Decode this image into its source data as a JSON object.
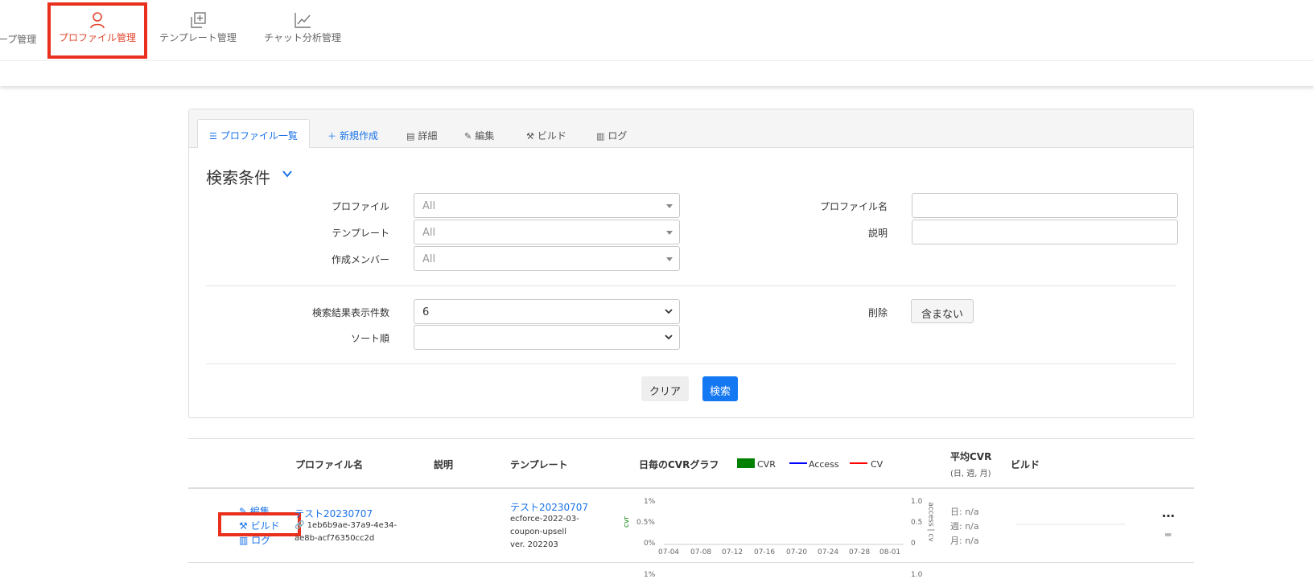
{
  "topnav": {
    "items": [
      {
        "label": "ープ管理",
        "active": false
      },
      {
        "label": "プロファイル管理",
        "active": true
      },
      {
        "label": "テンプレート管理",
        "active": false
      },
      {
        "label": "チャット分析管理",
        "active": false
      }
    ]
  },
  "tabs": [
    {
      "label": "プロファイル一覧",
      "icon": "list-icon"
    },
    {
      "label": "新規作成",
      "icon": "plus-icon"
    },
    {
      "label": "詳細",
      "icon": "document-icon"
    },
    {
      "label": "編集",
      "icon": "edit-icon"
    },
    {
      "label": "ビルド",
      "icon": "wrench-icon"
    },
    {
      "label": "ログ",
      "icon": "chart-icon"
    }
  ],
  "search": {
    "title": "検索条件",
    "profile_label": "プロファイル",
    "profile_value": "All",
    "template_label": "テンプレート",
    "template_value": "All",
    "member_label": "作成メンバー",
    "member_value": "All",
    "profile_name_label": "プロファイル名",
    "description_label": "説明",
    "count_label": "検索結果表示件数",
    "count_value": "6",
    "sort_label": "ソート順",
    "sort_value": "",
    "delete_label": "削除",
    "delete_toggle": "含まない",
    "clear_button": "クリア",
    "search_button": "検索"
  },
  "table": {
    "headers": {
      "profile_name": "プロファイル名",
      "description": "説明",
      "template": "テンプレート",
      "daily_cvr": "日毎のCVRグラフ",
      "avg_cvr": "平均CVR",
      "avg_cvr_sub": "(日, 週, 月)",
      "build": "ビルド"
    },
    "legend": [
      {
        "label": "CVR",
        "color": "#008000"
      },
      {
        "label": "Access",
        "color": "#0000ff"
      },
      {
        "label": "CV",
        "color": "#ff0000"
      }
    ],
    "rows": [
      {
        "actions": {
          "edit": "編集",
          "build": "ビルド",
          "log": "ログ"
        },
        "name": "テスト20230707",
        "id_line1": "1eb6b9ae-37a9-4e34-",
        "id_line2": "ae8b-acf76350cc2d",
        "template_name": "テスト20230707",
        "template_line1": "ecforce-2022-03-",
        "template_line2": "coupon-upsell",
        "template_line3": "ver. 202203",
        "chart": {
          "y_left": [
            "1%",
            "0.5%",
            "0%"
          ],
          "y_left_label": "cvr",
          "y_right": [
            "1.0",
            "0.5",
            "0"
          ],
          "y_right_label": "access | cv",
          "x_ticks": [
            "07-04",
            "07-08",
            "07-12",
            "07-16",
            "07-20",
            "07-24",
            "07-28",
            "08-01"
          ]
        },
        "avg": {
          "day": "日: n/a",
          "week": "週: n/a",
          "month": "月: n/a"
        }
      }
    ],
    "next_row": {
      "y_left_top": "1%",
      "y_right_top": "1.0"
    }
  }
}
